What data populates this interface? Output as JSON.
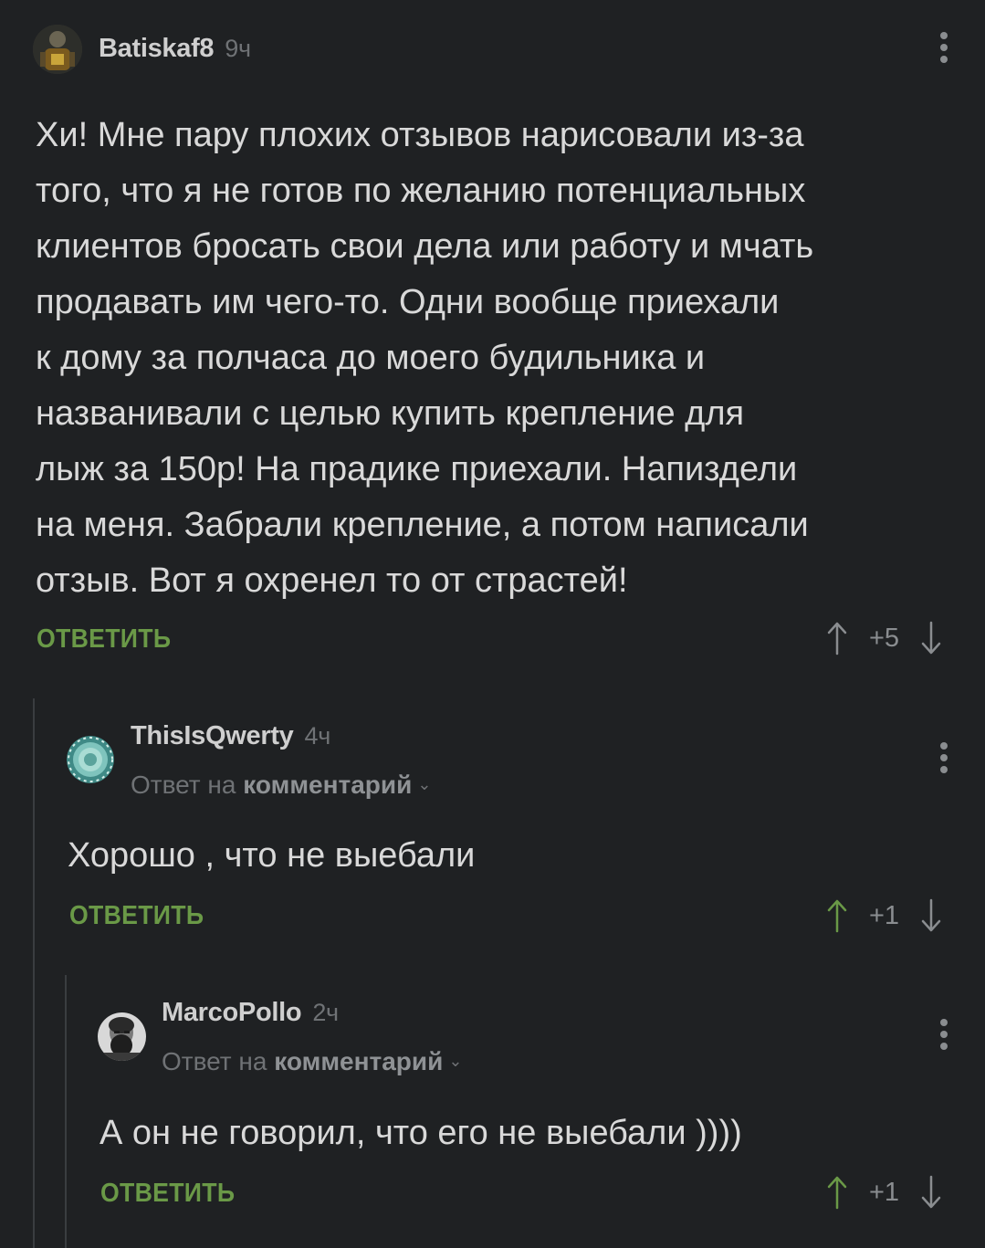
{
  "comments": [
    {
      "author": "Batiskaf8",
      "time": "9ч",
      "lines": [
        "Хи! Мне пару плохих отзывов нарисовали из-за",
        "того, что я не готов по желанию потенциальных",
        "клиентов бросать свои дела или работу и мчать",
        "продавать им чего-то. Одни вообще приехали",
        "к дому за полчаса до моего будильника и",
        "названивали с целью купить крепление для",
        "лыж за 150р! На прадике приехали. Напиздели",
        "на меня. Забрали крепление, а потом написали",
        "отзыв. Вот я охренел то от страстей!"
      ],
      "reply_label": "ОТВЕТИТЬ",
      "score": "+5",
      "up_color": "#8a8d90"
    },
    {
      "author": "ThisIsQwerty",
      "time": "4ч",
      "reply_prefix": "Ответ на",
      "reply_target": "комментарий",
      "text": "Хорошо , что не выебали",
      "reply_label": "ОТВЕТИТЬ",
      "score": "+1",
      "up_color": "#6a9947"
    },
    {
      "author": "MarcoPollo",
      "time": "2ч",
      "reply_prefix": "Ответ на",
      "reply_target": "комментарий",
      "text": "А он не говорил, что его не выебали ))))",
      "reply_label": "ОТВЕТИТЬ",
      "score": "+1",
      "up_color": "#6a9947"
    }
  ],
  "icons": {
    "more": "kebab-menu-icon",
    "upvote": "arrow-up-icon",
    "downvote": "arrow-down-icon",
    "chevron": "chevron-down-icon"
  }
}
